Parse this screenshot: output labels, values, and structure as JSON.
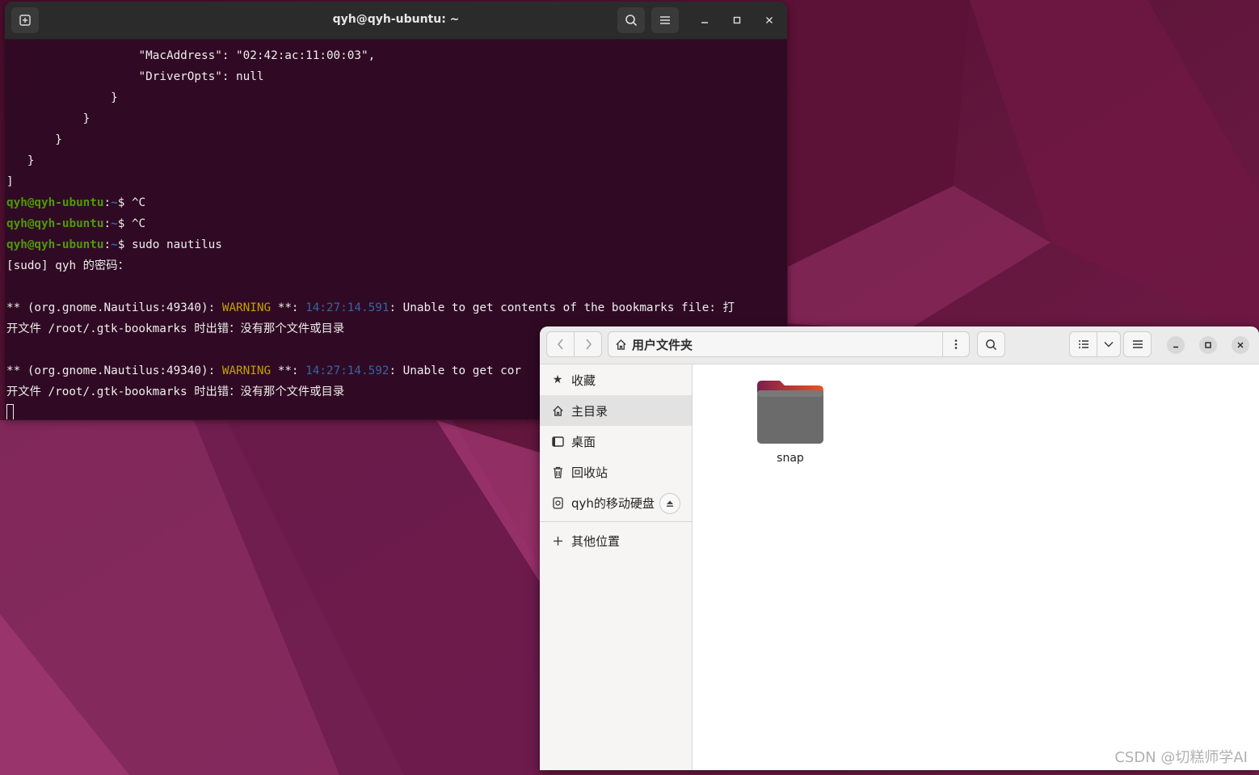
{
  "terminal": {
    "title": "qyh@qyh-ubuntu: ~",
    "lines": [
      {
        "pre": "                   \"MacAddress\": \"02:42:ac:11:00:03\","
      },
      {
        "pre": "                   \"DriverOpts\": null"
      },
      {
        "pre": "               }"
      },
      {
        "pre": "           }"
      },
      {
        "pre": "       }"
      },
      {
        "pre": "   }"
      },
      {
        "pre": "]"
      }
    ],
    "prompt_user": "qyh@qyh-ubuntu",
    "prompt_path": "~",
    "prompt_sep": ":",
    "prompt_dollar": "$ ",
    "commands": [
      "^C",
      "^C",
      "sudo nautilus"
    ],
    "sudo_prompt": "[sudo] qyh 的密码：",
    "warn1_prefix": "** (org.gnome.Nautilus:49340): ",
    "warn_word": "WARNING",
    "warn_stars": " **: ",
    "warn1_time": "14:27:14.591",
    "warn1_msg": ": Unable to get contents of the bookmarks file: 打",
    "warn1_cont": "开文件 /root/.gtk-bookmarks 时出错：没有那个文件或目录",
    "warn2_prefix": "** (org.gnome.Nautilus:49340): ",
    "warn2_time": "14:27:14.592",
    "warn2_msg": ": Unable to get cor",
    "warn2_cont": "开文件 /root/.gtk-bookmarks 时出错：没有那个文件或目录"
  },
  "files": {
    "path_label": "用户文件夹",
    "sidebar": [
      {
        "label": "收藏",
        "icon": "star-icon"
      },
      {
        "label": "主目录",
        "icon": "home-icon"
      },
      {
        "label": "桌面",
        "icon": "desktop-icon"
      },
      {
        "label": "回收站",
        "icon": "trash-icon"
      },
      {
        "label": "qyh的移动硬盘",
        "icon": "drive-icon"
      }
    ],
    "other_locations": "其他位置",
    "folder_name": "snap"
  },
  "watermark": "CSDN @切糕师学AI",
  "colors": {
    "terminal_bg": "#300a24",
    "prompt_user": "#4e9a06",
    "prompt_path": "#3465a4",
    "warning": "#c4a000",
    "folder_top": "#e95420"
  }
}
